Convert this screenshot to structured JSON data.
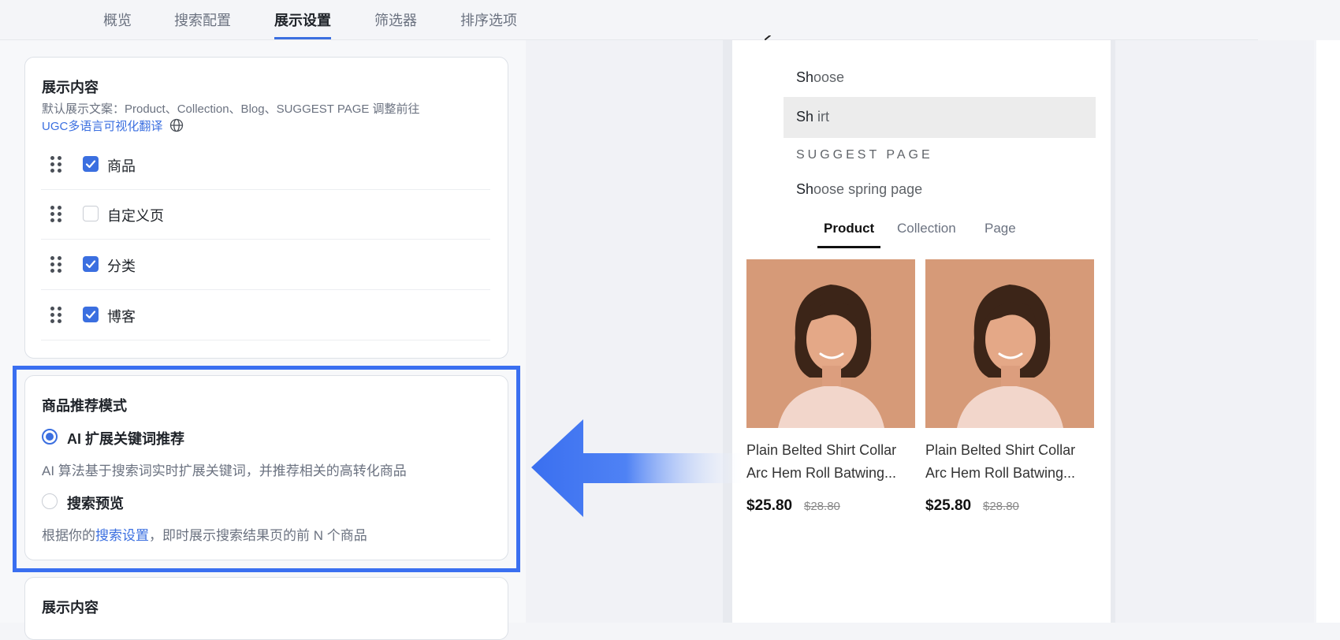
{
  "tabs": [
    "概览",
    "搜索配置",
    "展示设置",
    "筛选器",
    "排序选项"
  ],
  "active_tab": "展示设置",
  "display_card": {
    "title": "展示内容",
    "desc_line1": "默认展示文案：Product、Collection、Blog、SUGGEST PAGE 调整前往",
    "desc_link": "UGC多语言可视化翻译",
    "items": [
      {
        "label": "商品",
        "checked": true
      },
      {
        "label": "自定义页",
        "checked": false
      },
      {
        "label": "分类",
        "checked": true
      },
      {
        "label": "博客",
        "checked": true
      }
    ]
  },
  "recommend_card": {
    "title": "商品推荐模式",
    "option1_label": "AI 扩展关键词推荐",
    "option1_desc": "AI 算法基于搜索词实时扩展关键词，并推荐相关的高转化商品",
    "option2_label": "搜索预览",
    "option2_desc_prefix": "根据你的",
    "option2_desc_link": "搜索设置",
    "option2_desc_suffix": "，即时展示搜索结果页的前 N 个商品",
    "selected": "option1"
  },
  "bottom_card": {
    "title": "展示内容"
  },
  "preview": {
    "suggestions": [
      {
        "bold": "Sh",
        "rest": "oose"
      },
      {
        "bold": "Sh",
        "rest": " irt"
      }
    ],
    "suggest_header": "SUGGEST PAGE",
    "page_suggestion": {
      "bold": "Sh",
      "rest": "oose spring page"
    },
    "tabs": [
      "Product",
      "Collection",
      "Page"
    ],
    "active_tab": "Product",
    "products": [
      {
        "title_line1": "Plain Belted Shirt Collar",
        "title_line2": "Arc Hem Roll Batwing...",
        "price": "$25.80",
        "old_price": "$28.80"
      },
      {
        "title_line1": "Plain Belted Shirt Collar",
        "title_line2": "Arc Hem Roll Batwing...",
        "price": "$25.80",
        "old_price": "$28.80"
      }
    ]
  },
  "colors": {
    "accent": "#3b6fe0",
    "highlight": "#3a6ff0"
  }
}
